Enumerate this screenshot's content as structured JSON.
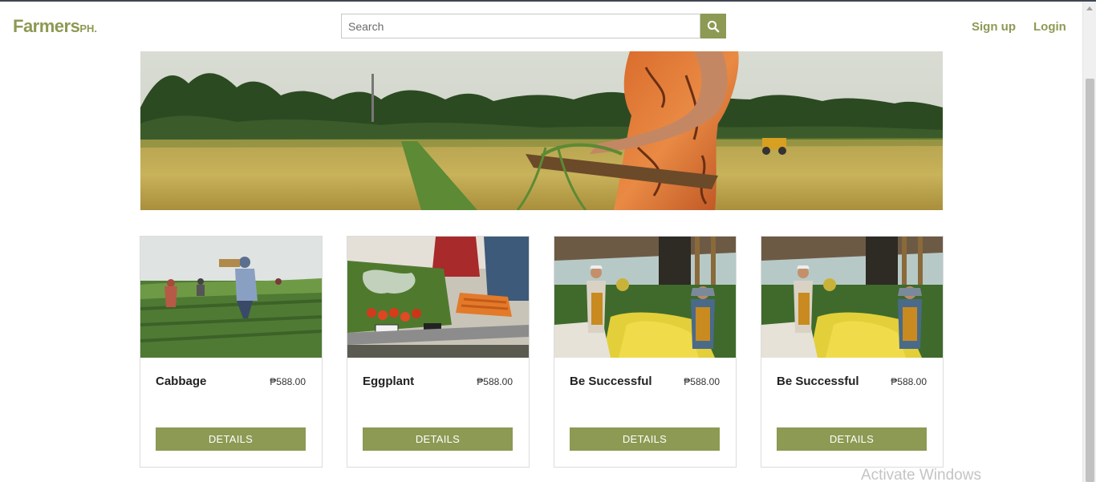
{
  "brand": {
    "name": "Farmers",
    "suffix": "PH."
  },
  "search": {
    "placeholder": "Search",
    "value": ""
  },
  "nav": {
    "signup": "Sign up",
    "login": "Login"
  },
  "colors": {
    "accent": "#8c9a53",
    "text": "#222222"
  },
  "products": [
    {
      "title": "Cabbage",
      "price": "₱588.00",
      "button": "DETAILS",
      "image": "farmers-in-field-photo"
    },
    {
      "title": "Eggplant",
      "price": "₱588.00",
      "button": "DETAILS",
      "image": "vegetable-market-stall-photo"
    },
    {
      "title": "Be Successful",
      "price": "₱588.00",
      "button": "DETAILS",
      "image": "flower-farm-workers-photo"
    },
    {
      "title": "Be Successful",
      "price": "₱588.00",
      "button": "DETAILS",
      "image": "flower-farm-workers-photo"
    }
  ],
  "watermark": "Activate Windows"
}
